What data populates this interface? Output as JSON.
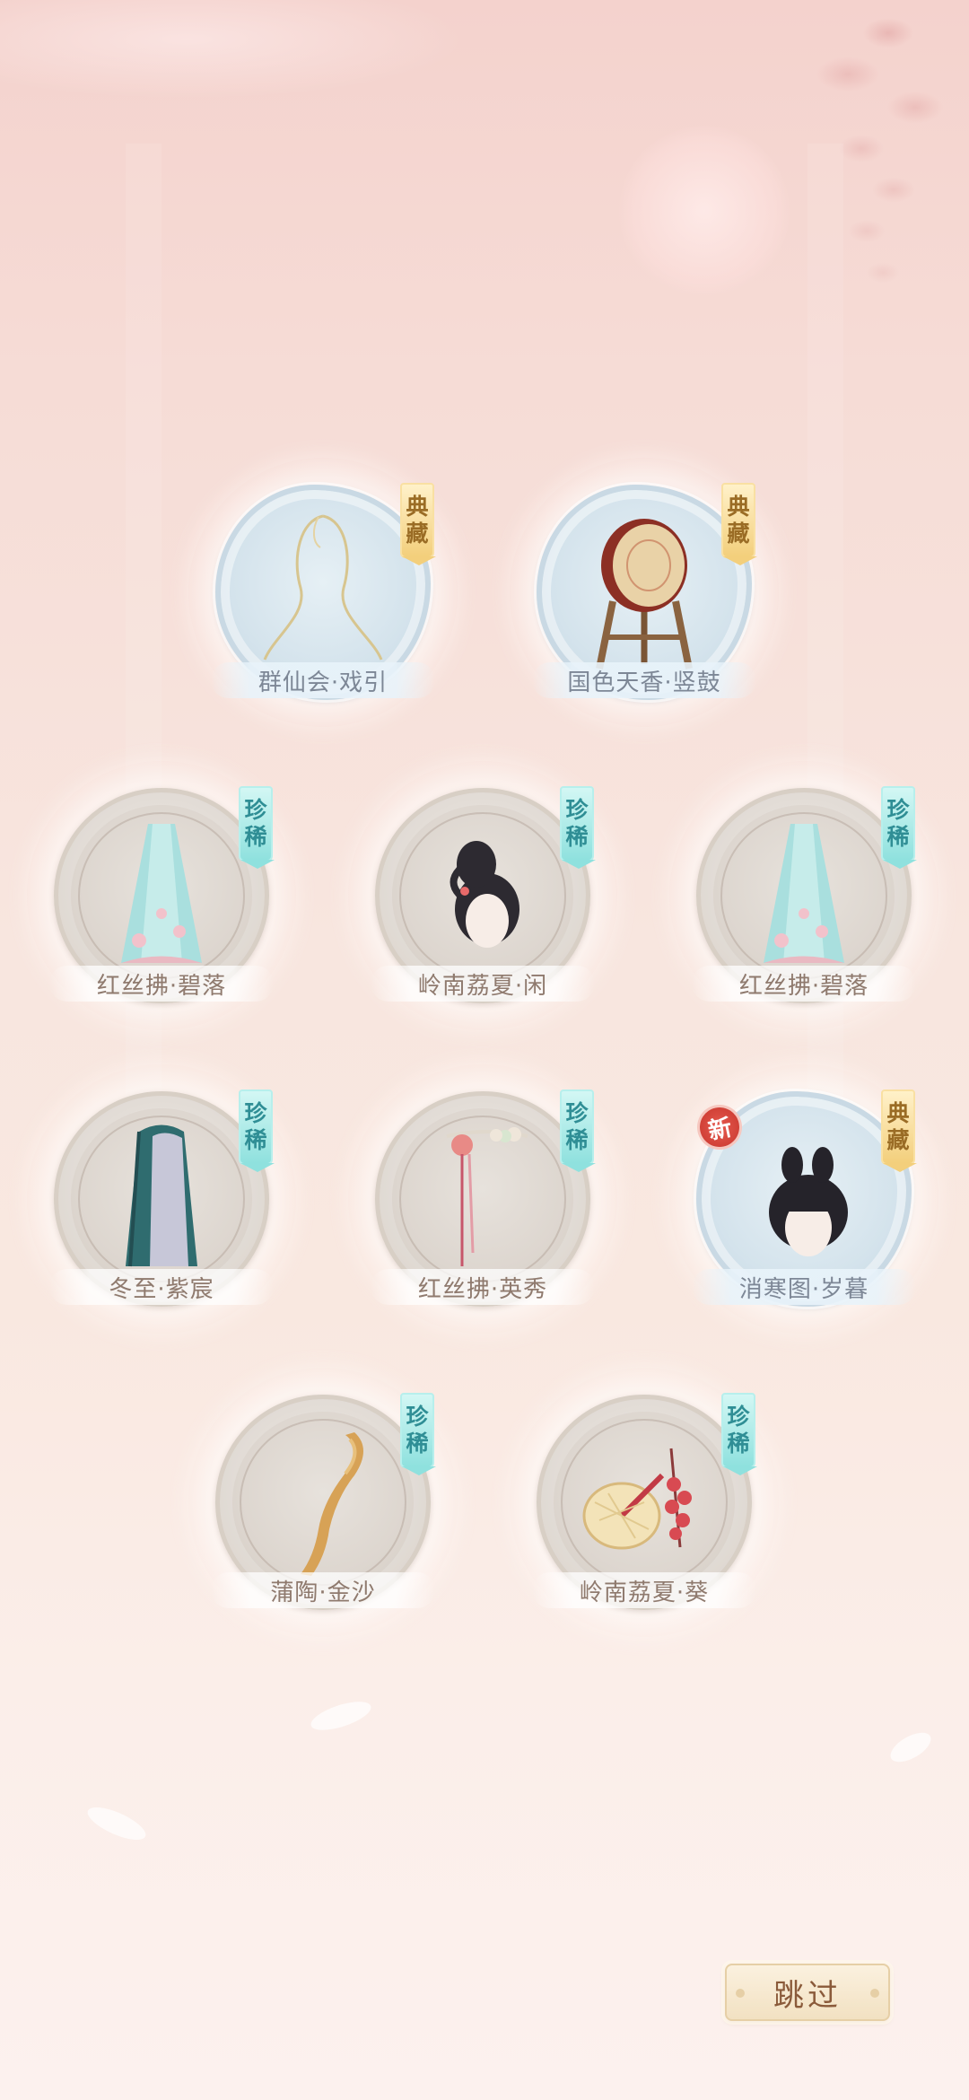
{
  "badges": {
    "rare": [
      "珍",
      "稀"
    ],
    "collection": [
      "典",
      "藏"
    ],
    "new": "新"
  },
  "items": [
    {
      "name": "群仙会·戏引",
      "tier": "collection",
      "icon": "jewelry-chain-icon",
      "is_new": false
    },
    {
      "name": "国色天香·竖鼓",
      "tier": "collection",
      "icon": "standing-drum-icon",
      "is_new": false
    },
    {
      "name": "红丝拂·碧落",
      "tier": "rare",
      "icon": "skirt-icon",
      "is_new": false
    },
    {
      "name": "岭南荔夏·闲",
      "tier": "rare",
      "icon": "hairstyle-icon",
      "is_new": false
    },
    {
      "name": "红丝拂·碧落",
      "tier": "rare",
      "icon": "skirt-icon",
      "is_new": false
    },
    {
      "name": "冬至·紫宸",
      "tier": "rare",
      "icon": "cloak-icon",
      "is_new": false
    },
    {
      "name": "红丝拂·英秀",
      "tier": "rare",
      "icon": "hairpin-icon",
      "is_new": false
    },
    {
      "name": "消寒图·岁暮",
      "tier": "collection",
      "icon": "hairstyle-icon",
      "is_new": true
    },
    {
      "name": "蒲陶·金沙",
      "tier": "rare",
      "icon": "golden-ribbon-icon",
      "is_new": false
    },
    {
      "name": "岭南荔夏·葵",
      "tier": "rare",
      "icon": "fan-lychee-icon",
      "is_new": false
    }
  ],
  "skip_label": "跳过",
  "colors": {
    "rare_badge": "#8fe1de",
    "collection_badge": "#f3cf7c",
    "new_badge": "#d4433a",
    "background": "#f6dcd6"
  }
}
